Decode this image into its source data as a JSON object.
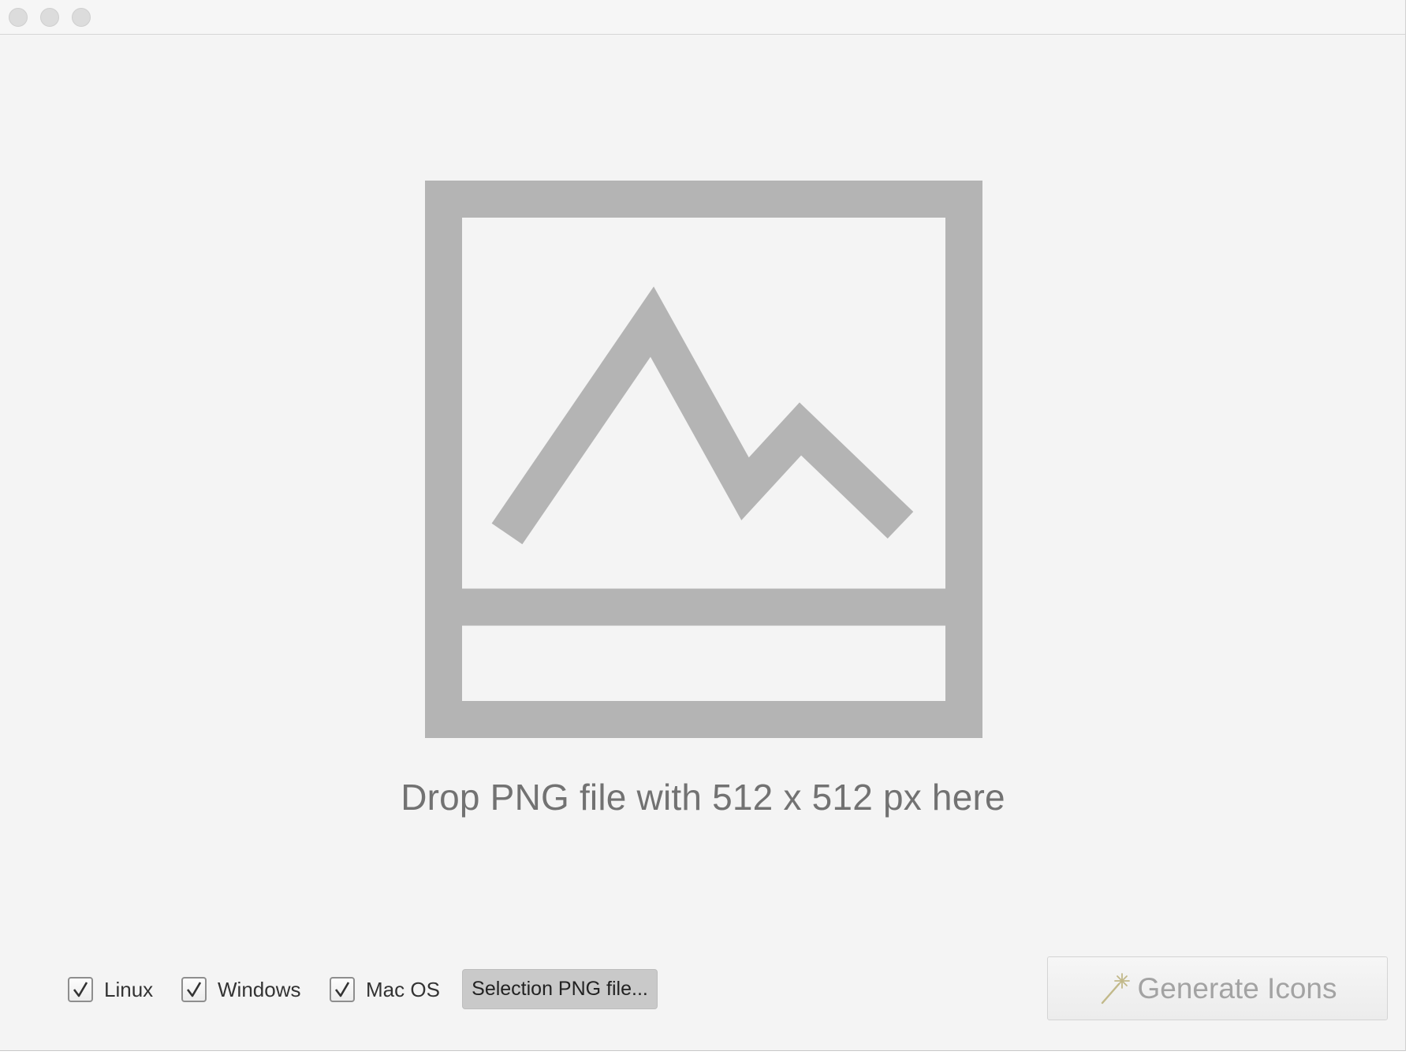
{
  "window": {
    "controls": [
      "close",
      "minimize",
      "zoom"
    ]
  },
  "drop_zone": {
    "icon": "image-placeholder-icon",
    "text": "Drop PNG file with 512 x 512 px here"
  },
  "options": {
    "platforms": [
      {
        "label": "Linux",
        "checked": true
      },
      {
        "label": "Windows",
        "checked": true
      },
      {
        "label": "Mac OS",
        "checked": true
      }
    ],
    "select_button_label": "Selection PNG file..."
  },
  "generate_button": {
    "label": "Generate Icons",
    "icon": "magic-wand-icon",
    "enabled": false
  },
  "colors": {
    "background": "#f4f4f4",
    "icon_gray": "#b4b4b4",
    "text_gray": "#727272",
    "disabled_text": "#a3a3a3",
    "wand_color": "#c2b98a"
  }
}
